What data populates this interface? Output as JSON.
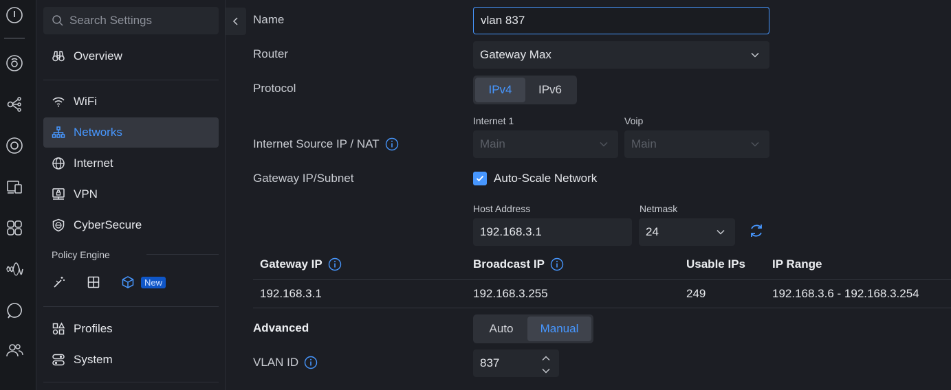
{
  "rail": {
    "icons": [
      "logo-icon",
      "dashboard-icon",
      "topology-icon",
      "devices-icon",
      "clients-icon",
      "apps-icon",
      "insights-icon",
      "support-icon",
      "admins-icon"
    ]
  },
  "sidebar": {
    "search_placeholder": "Search Settings",
    "items": [
      {
        "label": "Overview"
      },
      {
        "label": "WiFi"
      },
      {
        "label": "Networks"
      },
      {
        "label": "Internet"
      },
      {
        "label": "VPN"
      },
      {
        "label": "CyberSecure"
      },
      {
        "label": "Profiles"
      },
      {
        "label": "System"
      }
    ],
    "policy_engine_label": "Policy Engine",
    "new_badge": "New"
  },
  "form": {
    "name_label": "Name",
    "name_value": "vlan 837",
    "router_label": "Router",
    "router_value": "Gateway Max",
    "protocol_label": "Protocol",
    "protocol_options": [
      "IPv4",
      "IPv6"
    ],
    "protocol_selected": "IPv4",
    "internet_source_label": "Internet Source IP / NAT",
    "internet1_label": "Internet 1",
    "internet1_value": "Main",
    "voip_label": "Voip",
    "voip_value": "Main",
    "gateway_subnet_label": "Gateway IP/Subnet",
    "auto_scale_label": "Auto-Scale Network",
    "auto_scale_checked": true,
    "host_address_label": "Host Address",
    "host_address_value": "192.168.3.1",
    "netmask_label": "Netmask",
    "netmask_value": "24",
    "advanced_label": "Advanced",
    "advanced_options": [
      "Auto",
      "Manual"
    ],
    "advanced_selected": "Manual",
    "vlan_id_label": "VLAN ID",
    "vlan_id_value": "837"
  },
  "table": {
    "headers": [
      "Gateway IP",
      "Broadcast IP",
      "Usable IPs",
      "IP Range"
    ],
    "row": [
      "192.168.3.1",
      "192.168.3.255",
      "249",
      "192.168.3.6 - 192.168.3.254"
    ]
  },
  "colors": {
    "accent": "#4797ff",
    "background": "#1c1e24",
    "field": "#25282e"
  }
}
